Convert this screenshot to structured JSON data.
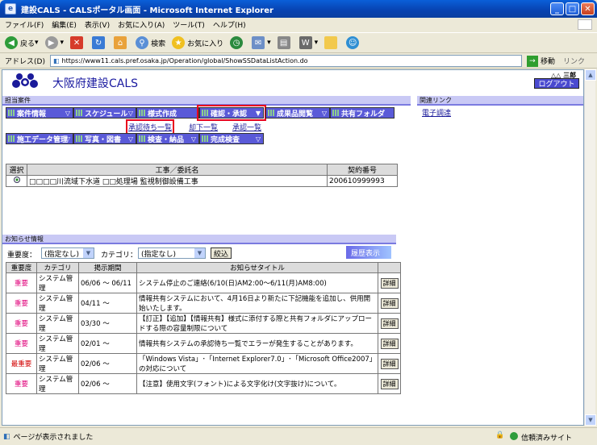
{
  "window": {
    "title": "建設CALS - CALSポータル画面 - Microsoft Internet Explorer"
  },
  "menu": [
    "ファイル(F)",
    "編集(E)",
    "表示(V)",
    "お気に入り(A)",
    "ツール(T)",
    "ヘルプ(H)"
  ],
  "toolbar": {
    "back": "戻る",
    "search": "検索",
    "favorites": "お気に入り"
  },
  "address": {
    "label": "アドレス(D)",
    "url": "https://www11.cals.pref.osaka.jp/Operation/global/ShowSSDataListAction.do",
    "go": "移動",
    "links": "リンク"
  },
  "site": {
    "title": "大阪府建設CALS",
    "user": "△△ 三郎",
    "logout": "ログアウト"
  },
  "projects": {
    "section_label": "担当案件",
    "nav_row1": [
      "案件情報",
      "スケジュール",
      "様式作成",
      "確認・承認",
      "成果品閲覧",
      "共有フォルダ"
    ],
    "sublinks": [
      "承認待ち一覧",
      "却下一覧",
      "承認一覧"
    ],
    "nav_row2": [
      "施工データ管理",
      "写真・図書",
      "検査・納品",
      "完成検査"
    ],
    "table_headers": [
      "選択",
      "工事／委託名",
      "契約番号"
    ],
    "rows": [
      {
        "name": "□□□□川流域下水道 □□処理場 監視制御設備工事",
        "contract": "200610999993"
      }
    ]
  },
  "related": {
    "section_label": "関連リンク",
    "link": "電子調達"
  },
  "notices": {
    "section_label": "お知らせ情報",
    "importance_label": "重要度：",
    "importance_value": "(指定なし)",
    "category_label": "カテゴリ：",
    "category_value": "(指定なし)",
    "filter_button": "絞込",
    "history_button": "履歴表示",
    "headers": [
      "重要度",
      "カテゴリ",
      "掲示期間",
      "お知らせタイトル",
      ""
    ],
    "detail_label": "詳細",
    "rows": [
      {
        "importance": "重要",
        "level": "important",
        "category": "システム管理",
        "period": "06/06 ～ 06/11",
        "title": "システム停止のご連絡(6/10(日)AM2:00～6/11(月)AM8:00)"
      },
      {
        "importance": "重要",
        "level": "important",
        "category": "システム管理",
        "period": "04/11 ～",
        "title": "情報共有システムにおいて、4月16日より新たに下記機能を追加し、供用開始いたします。"
      },
      {
        "importance": "重要",
        "level": "important",
        "category": "システム管理",
        "period": "03/30 ～",
        "title": "【訂正】【追加】【情報共有】様式に添付する際と共有フォルダにアップロードする際の容量制限について"
      },
      {
        "importance": "重要",
        "level": "important",
        "category": "システム管理",
        "period": "02/01 ～",
        "title": "情報共有システムの承認待ち一覧でエラーが発生することがあります。"
      },
      {
        "importance": "最重要",
        "level": "top",
        "category": "システム管理",
        "period": "02/06 ～",
        "title": "「Windows Vista」･「Internet Explorer7.0」･「Microsoft Office2007」の対応について"
      },
      {
        "importance": "重要",
        "level": "important",
        "category": "システム管理",
        "period": "02/06 ～",
        "title": "【注意】使用文字(フォント)による文字化け(文字抜け)について。"
      }
    ]
  },
  "status": {
    "left": "ページが表示されました",
    "zone": "信頼済みサイト"
  }
}
